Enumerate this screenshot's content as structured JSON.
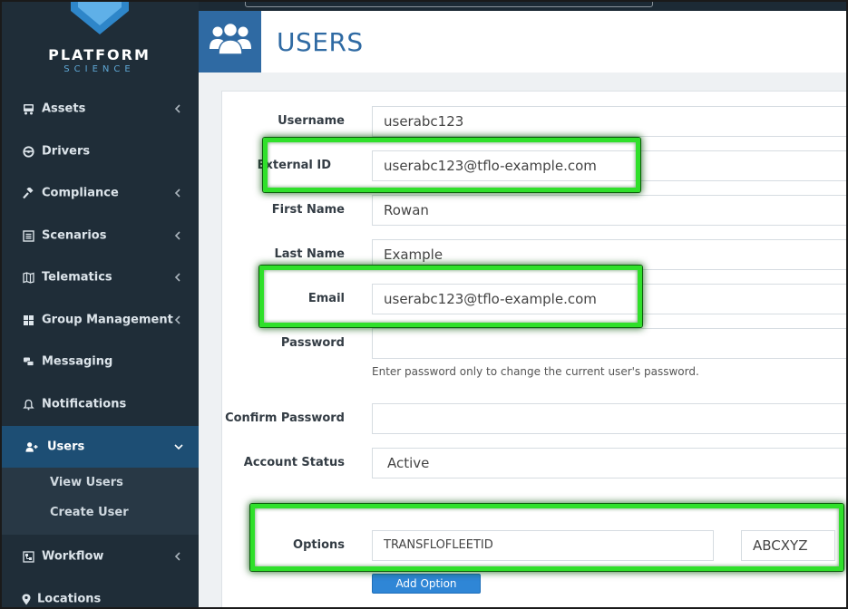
{
  "brand": {
    "name": "PLATFORM",
    "sub": "SCIENCE"
  },
  "sidebar": {
    "items": [
      {
        "label": "Assets",
        "icon": "truck-icon",
        "has_chevron": true
      },
      {
        "label": "Drivers",
        "icon": "steering-wheel-icon",
        "has_chevron": false
      },
      {
        "label": "Compliance",
        "icon": "gavel-icon",
        "has_chevron": true
      },
      {
        "label": "Scenarios",
        "icon": "list-icon",
        "has_chevron": true
      },
      {
        "label": "Telematics",
        "icon": "map-icon",
        "has_chevron": true
      },
      {
        "label": "Group Management",
        "icon": "grid-icon",
        "has_chevron": true
      },
      {
        "label": "Messaging",
        "icon": "chat-icon",
        "has_chevron": false
      },
      {
        "label": "Notifications",
        "icon": "bell-icon",
        "has_chevron": false
      },
      {
        "label": "Users",
        "icon": "user-plus-icon",
        "has_chevron": true,
        "active": true
      },
      {
        "label": "Workflow",
        "icon": "workflow-icon",
        "has_chevron": true
      },
      {
        "label": "Locations",
        "icon": "map-marker-icon",
        "has_chevron": false
      }
    ],
    "users_submenu": [
      "View Users",
      "Create User"
    ]
  },
  "header": {
    "title": "USERS",
    "icon": "users-group-icon"
  },
  "form": {
    "username": {
      "label": "Username",
      "value": "userabc123"
    },
    "external_id": {
      "label": "External ID",
      "value": "userabc123@tflo-example.com"
    },
    "first_name": {
      "label": "First Name",
      "value": "Rowan"
    },
    "last_name": {
      "label": "Last Name",
      "value": "Example"
    },
    "email": {
      "label": "Email",
      "value": "userabc123@tflo-example.com"
    },
    "password": {
      "label": "Password",
      "value": "",
      "help": "Enter password only to change the current user's password."
    },
    "confirm_password": {
      "label": "Confirm Password",
      "value": ""
    },
    "account_status": {
      "label": "Account Status",
      "value": "Active"
    },
    "options": {
      "label": "Options",
      "key": "TRANSFLOFLEETID",
      "value": "ABCXYZ"
    },
    "add_option_label": "Add Option"
  },
  "colors": {
    "sidebar_bg": "#1f2d38",
    "active_bg": "#1d4e74",
    "accent": "#2f6aa3",
    "highlight": "#2fe02a"
  }
}
